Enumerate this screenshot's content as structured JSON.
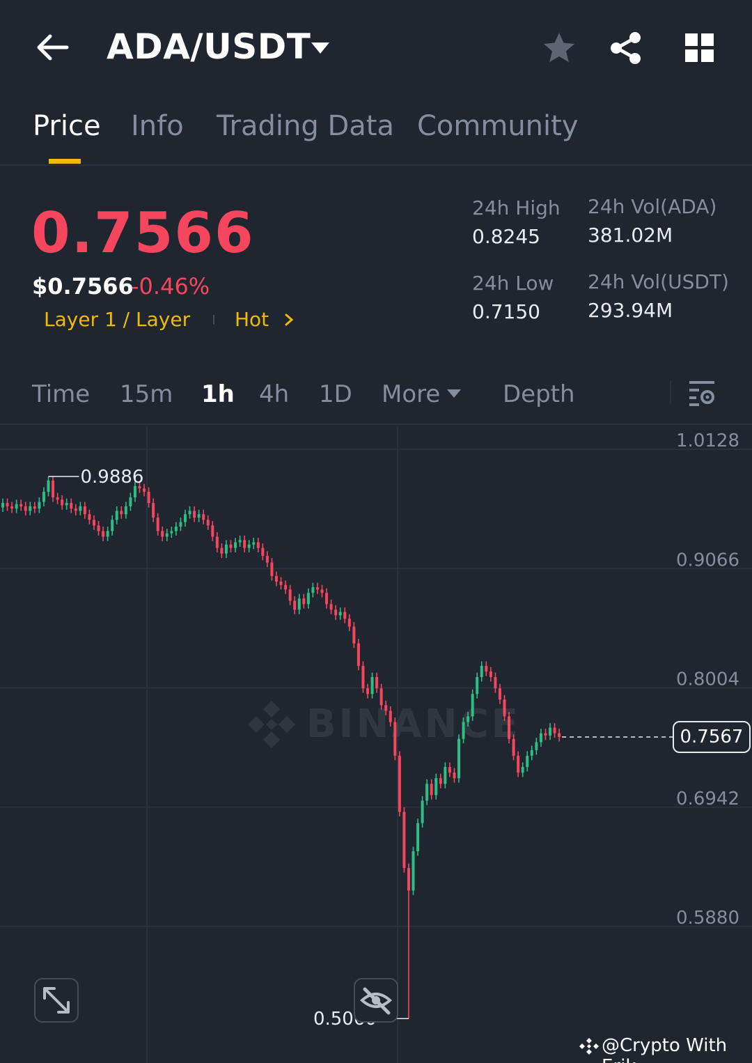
{
  "header": {
    "pair": "ADA/USDT",
    "icons": [
      "back-arrow-icon",
      "caret-down-icon",
      "star-icon",
      "share-icon",
      "grid-icon"
    ]
  },
  "tabs": [
    {
      "label": "Price",
      "active": true
    },
    {
      "label": "Info",
      "active": false
    },
    {
      "label": "Trading Data",
      "active": false
    },
    {
      "label": "Community",
      "active": false
    }
  ],
  "ticker": {
    "last_price": "0.7566",
    "usd_price": "$0.7566",
    "change": "-0.46%",
    "tag_category": "Layer 1 / Layer",
    "tag_hot": "Hot",
    "high_label": "24h High",
    "high_value": "0.8245",
    "low_label": "24h Low",
    "low_value": "0.7150",
    "vol_base_label": "24h Vol(ADA)",
    "vol_base_value": "381.02M",
    "vol_quote_label": "24h Vol(USDT)",
    "vol_quote_value": "293.94M"
  },
  "intervals": {
    "items": [
      "Time",
      "15m",
      "1h",
      "4h",
      "1D",
      "More",
      "Depth"
    ],
    "active": "1h"
  },
  "chart": {
    "axis_labels": [
      "1.0128",
      "0.9066",
      "0.8004",
      "0.6942",
      "0.5880"
    ],
    "high_marker": "0.9886",
    "low_marker": "0.5060",
    "current_price": "0.7567",
    "watermark": "BINANCE"
  },
  "credit": "@Crypto With Erik",
  "colors": {
    "background": "#1f2630",
    "up": "#2ebd85",
    "down": "#f6465d",
    "accent": "#f0b90b"
  },
  "chart_data": {
    "type": "candlestick",
    "interval": "1h",
    "ylim": [
      0.5,
      1.02
    ],
    "yticks": [
      1.0128,
      0.9066,
      0.8004,
      0.6942,
      0.588
    ],
    "marked_high": 0.9886,
    "marked_low": 0.506,
    "last": 0.7567,
    "closes": [
      0.965,
      0.962,
      0.96,
      0.964,
      0.962,
      0.958,
      0.962,
      0.96,
      0.966,
      0.975,
      0.985,
      0.97,
      0.968,
      0.963,
      0.965,
      0.96,
      0.958,
      0.962,
      0.955,
      0.95,
      0.945,
      0.94,
      0.935,
      0.94,
      0.95,
      0.958,
      0.955,
      0.962,
      0.97,
      0.98,
      0.978,
      0.975,
      0.965,
      0.952,
      0.94,
      0.935,
      0.938,
      0.94,
      0.944,
      0.948,
      0.955,
      0.958,
      0.952,
      0.955,
      0.95,
      0.945,
      0.935,
      0.925,
      0.92,
      0.928,
      0.925,
      0.93,
      0.932,
      0.925,
      0.928,
      0.93,
      0.925,
      0.918,
      0.912,
      0.9,
      0.895,
      0.892,
      0.888,
      0.878,
      0.87,
      0.88,
      0.875,
      0.885,
      0.89,
      0.888,
      0.885,
      0.875,
      0.87,
      0.865,
      0.868,
      0.862,
      0.855,
      0.84,
      0.82,
      0.8,
      0.795,
      0.81,
      0.8,
      0.785,
      0.78,
      0.77,
      0.74,
      0.69,
      0.64,
      0.62,
      0.655,
      0.68,
      0.7,
      0.715,
      0.705,
      0.72,
      0.715,
      0.73,
      0.725,
      0.72,
      0.755,
      0.77,
      0.775,
      0.795,
      0.81,
      0.82,
      0.815,
      0.81,
      0.8,
      0.79,
      0.775,
      0.755,
      0.74,
      0.725,
      0.73,
      0.74,
      0.745,
      0.752,
      0.76,
      0.758,
      0.765,
      0.76,
      0.7567
    ]
  }
}
